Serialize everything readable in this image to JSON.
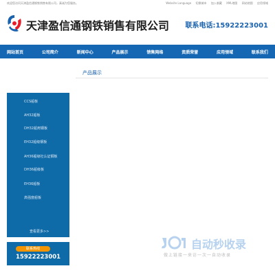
{
  "topbar": {
    "welcome": "欢迎您访问天津盈信通钢铁销售有限公司，真诚为您服务。",
    "links": [
      "Website Language",
      "切换城市",
      "加入收藏",
      "XML地图",
      "网站地图",
      "应用领域"
    ]
  },
  "header": {
    "company_name": "天津盈信通钢铁销售有限公司",
    "hotline": "联系电话:15922223001"
  },
  "nav": {
    "items": [
      "网站首页",
      "公司简介",
      "新闻中心",
      "产品展示",
      "销售网络",
      "资质荣誉",
      "应用领域",
      "联系我们"
    ]
  },
  "sidebar": {
    "items": [
      "CCS船板",
      "AH32船板",
      "DH32船用钢板",
      "EH32船级钢板",
      "AH36船级社认证钢板",
      "DH36船级板",
      "EH36船板",
      "高强度船板"
    ],
    "more": "查看更多>>"
  },
  "contact": {
    "label": "联系热线",
    "phone": "15922223001"
  },
  "main": {
    "title": "产品展示"
  },
  "watermark": {
    "text": "自动秒收录",
    "subtext": "做上链接一来访一次一自动收录"
  },
  "colors": {
    "nav_bg": "#1567b3",
    "sidebar_bg": "#0f6aa8",
    "accent_orange": "#f29400",
    "title_blue": "#1a62ad"
  }
}
